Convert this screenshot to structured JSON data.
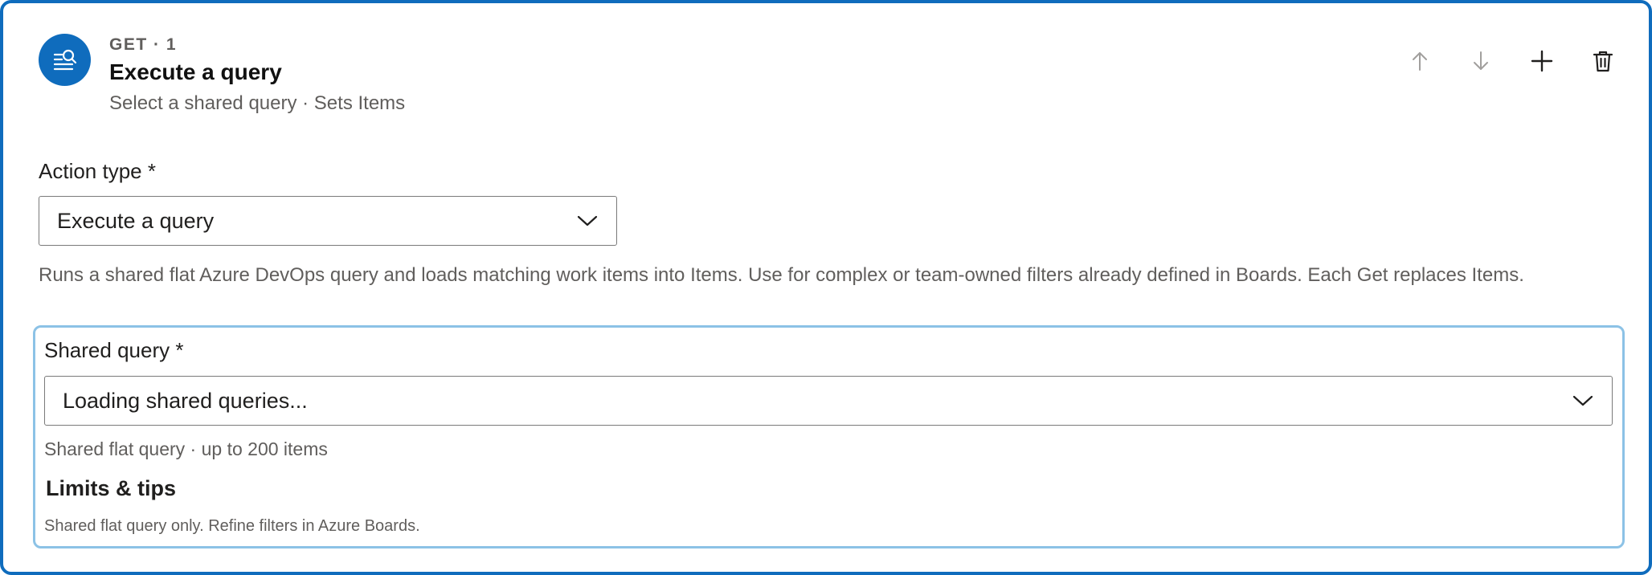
{
  "step": {
    "icon": "query-list-icon",
    "tag": "GET · 1",
    "title": "Execute a query",
    "subtitle": "Select a shared query · Sets Items"
  },
  "header_actions": [
    {
      "name": "move-up-button",
      "icon": "arrow-up-icon",
      "enabled": false
    },
    {
      "name": "move-down-button",
      "icon": "arrow-down-icon",
      "enabled": false
    },
    {
      "name": "add-step-button",
      "icon": "plus-icon",
      "enabled": true
    },
    {
      "name": "delete-step-button",
      "icon": "trash-icon",
      "enabled": true
    }
  ],
  "action_type": {
    "label": "Action type *",
    "value": "Execute a query",
    "description": "Runs a shared flat Azure DevOps query and loads matching work items into Items. Use for complex or team-owned filters already defined in Boards. Each Get replaces Items."
  },
  "shared_query": {
    "label": "Shared query *",
    "value": "Loading shared queries...",
    "hint": "Shared flat query · up to 200 items"
  },
  "tips": {
    "title": "Limits & tips",
    "text": "Shared flat query only. Refine filters in Azure Boards."
  },
  "colors": {
    "accent": "#0f6cbd",
    "panel_border": "#8cc2e6",
    "muted_text": "#605e5c",
    "disabled_icon": "#a19f9d"
  }
}
